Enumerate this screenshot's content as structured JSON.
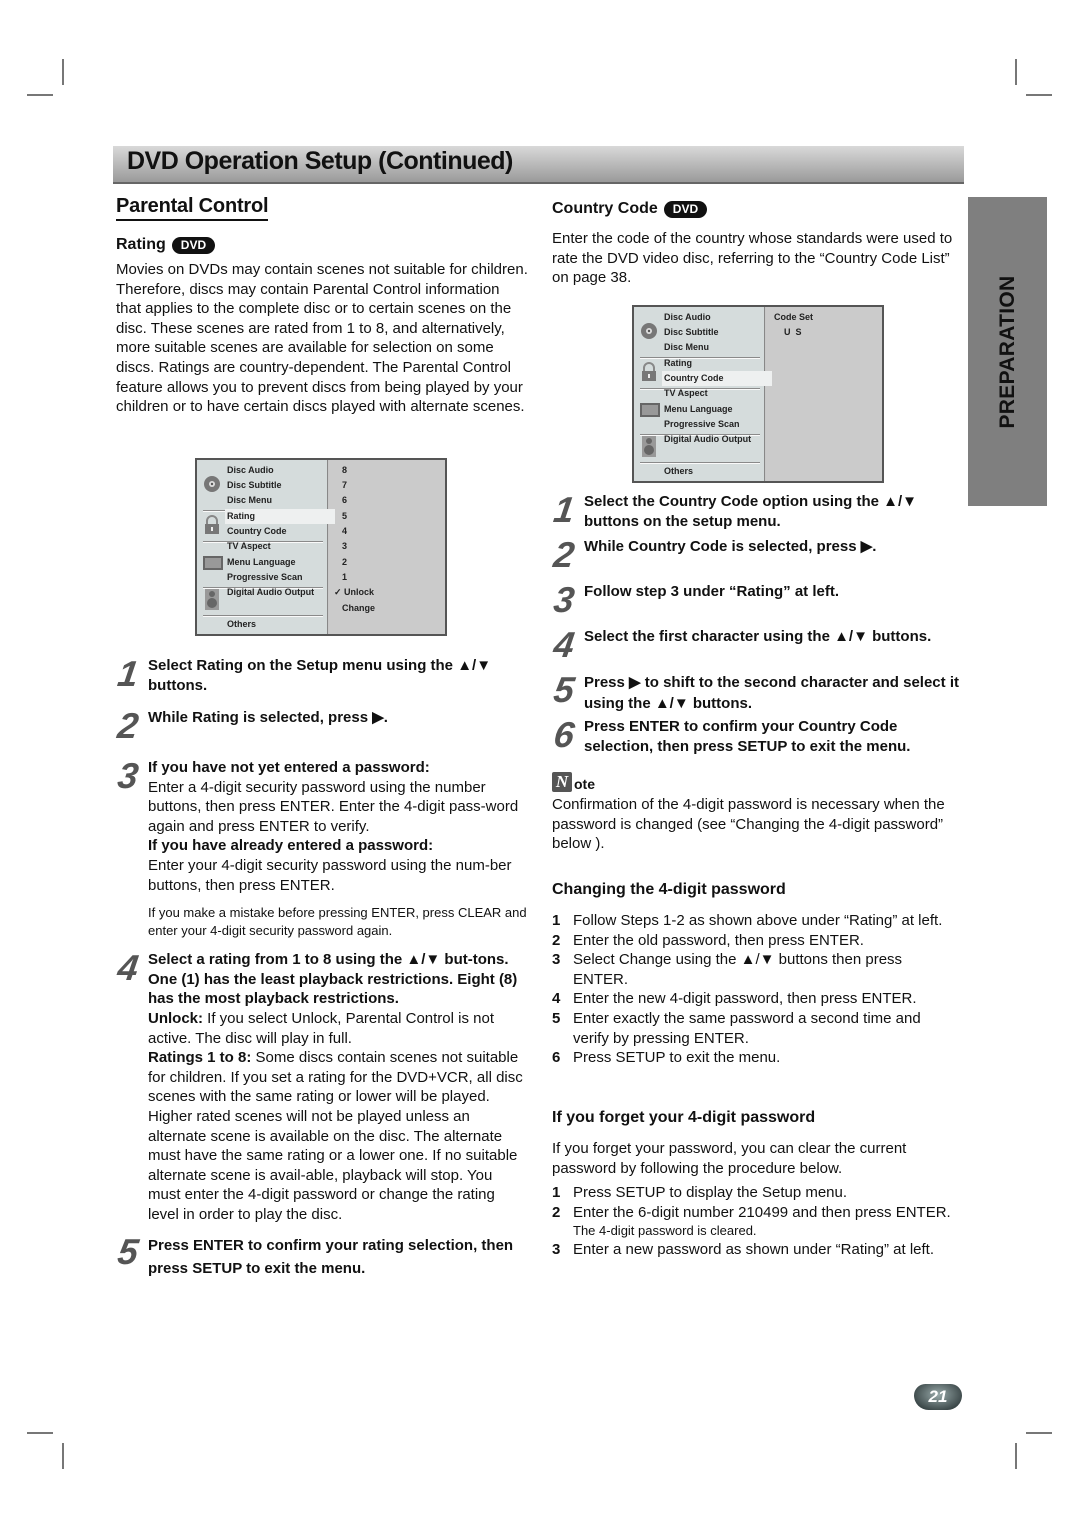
{
  "header": {
    "title": "DVD Operation Setup (Continued)"
  },
  "side_tab": {
    "label": "PREPARATION"
  },
  "page_number": "21",
  "left": {
    "section_title": "Parental Control",
    "rating": {
      "title": "Rating",
      "badge": "DVD",
      "intro": "Movies on DVDs may contain scenes not suitable for children. Therefore, discs may contain Parental Control information that applies to the complete disc or to certain scenes on the disc. These scenes are rated from 1 to 8, and alternatively, more suitable scenes are available for selection on some discs. Ratings are country-dependent. The Parental Control feature allows you to prevent discs from being played by your children or to have certain discs played with alternate scenes."
    },
    "menu": {
      "items": [
        "Disc Audio",
        "Disc Subtitle",
        "Disc Menu",
        "Rating",
        "Country Code",
        "TV Aspect",
        "Menu Language",
        "Progressive Scan",
        "Digital Audio Output",
        "Others"
      ],
      "selected": "Rating",
      "values": [
        "8",
        "7",
        "6",
        "5",
        "4",
        "3",
        "2",
        "1",
        "✓ Unlock",
        "Change"
      ]
    },
    "steps": [
      {
        "num": "1",
        "text": "Select Rating on the Setup menu using the ▲/▼ buttons."
      },
      {
        "num": "2",
        "text": "While Rating is selected, press ▶."
      },
      {
        "num": "3",
        "head1": "If you have not yet entered a password:",
        "body1": "Enter a 4-digit security password using the number buttons, then press ENTER. Enter the 4-digit pass-word again and press ENTER to verify.",
        "head2": "If you have already entered a password:",
        "body2": "Enter your 4-digit security password using the num-ber buttons, then press ENTER.",
        "tip": "If you make a mistake before pressing ENTER, press CLEAR and enter your 4-digit security password again."
      },
      {
        "num": "4",
        "head": "Select a rating from 1 to 8 using the ▲/▼ but-tons. One (1) has the least playback restrictions. Eight (8) has the most playback restrictions.",
        "unlock_label": "Unlock:",
        "unlock_text": " If you select Unlock, Parental Control is not active. The disc will play in full.",
        "ratings_label": "Ratings 1 to 8:",
        "ratings_text": " Some discs contain scenes not suitable for children. If you set a rating for the DVD+VCR, all disc scenes with the same rating or lower will be played. Higher rated scenes will not be played unless an alternate scene is available on the disc. The alternate must have the same rating or a lower one. If no suitable alternate scene is avail-able, playback will stop. You must enter the 4-digit password or change the rating level in order to play the disc."
      },
      {
        "num": "5",
        "text": "Press ENTER to confirm your rating selection, then press SETUP to exit the menu."
      }
    ]
  },
  "right": {
    "country_code": {
      "title": "Country Code",
      "badge": "DVD",
      "intro": "Enter the code of the country whose standards were used to rate the DVD video disc, referring to the “Country Code List” on page 38."
    },
    "menu": {
      "items": [
        "Disc Audio",
        "Disc Subtitle",
        "Disc Menu",
        "Rating",
        "Country Code",
        "TV Aspect",
        "Menu Language",
        "Progressive Scan",
        "Digital Audio Output",
        "Others"
      ],
      "selected": "Country Code",
      "value_label": "Code Set",
      "value": "U  S"
    },
    "steps": [
      {
        "num": "1",
        "text": "Select the Country Code option using the ▲/▼ buttons on the setup menu."
      },
      {
        "num": "2",
        "text": "While Country Code is selected, press ▶."
      },
      {
        "num": "3",
        "text": "Follow step 3 under “Rating” at left."
      },
      {
        "num": "4",
        "text": "Select the first character using the ▲/▼ buttons."
      },
      {
        "num": "5",
        "text": "Press ▶ to shift to the second character and select it using the ▲/▼ buttons."
      },
      {
        "num": "6",
        "text": "Press ENTER to confirm your Country Code selection, then press SETUP to exit the menu."
      }
    ],
    "note": {
      "icon_letter": "N",
      "label": "ote",
      "text": "Confirmation of the 4-digit password is necessary when the password is changed (see “Changing the 4-digit password” below )."
    },
    "changing": {
      "title": "Changing the 4-digit password",
      "items": [
        {
          "n": "1",
          "text": "Follow Steps 1-2 as shown above under “Rating” at left."
        },
        {
          "n": "2",
          "text": "Enter the old password, then press ENTER."
        },
        {
          "n": "3",
          "text": "Select Change using the ▲/▼ buttons then press ENTER."
        },
        {
          "n": "4",
          "text": "Enter the new 4-digit password, then press ENTER."
        },
        {
          "n": "5",
          "text": "Enter exactly the same password a second time and verify by pressing ENTER."
        },
        {
          "n": "6",
          "text": "Press SETUP to exit the menu."
        }
      ]
    },
    "forget": {
      "title": "If you forget your 4-digit password",
      "intro": "If you forget your password, you can clear the current password by following the procedure below.",
      "items": [
        {
          "n": "1",
          "text": "Press SETUP to display the Setup menu."
        },
        {
          "n": "2",
          "text": "Enter the 6-digit number 210499 and then press ENTER.",
          "sub": "The 4-digit password is cleared."
        },
        {
          "n": "3",
          "text": "Enter a new password as shown under “Rating” at left."
        }
      ]
    }
  }
}
